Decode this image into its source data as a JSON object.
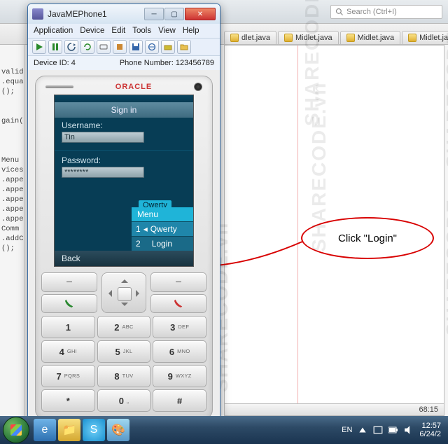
{
  "ide": {
    "search_placeholder": "Search (Ctrl+I)",
    "tabs": [
      {
        "label": "dlet.java"
      },
      {
        "label": "Midlet.java"
      },
      {
        "label": "Midlet.java"
      },
      {
        "label": "Midlet.java..."
      }
    ],
    "status": "68:15",
    "left_code": "\n\nvalid\n.equa\n();\n\n\ngain(\n\n\n\nMenu (\nvices\n.appe\n.appe\n.appe\n.appe\n.appe\nComm\n.addC\n();"
  },
  "annotation": {
    "text": "Click \"Login\""
  },
  "watermark": "SHARECODE.vn",
  "taskbar": {
    "lang": "EN",
    "time": "12:57",
    "date": "6/24/2"
  },
  "emuwin": {
    "title": "JavaMEPhone1",
    "menus": [
      "Application",
      "Device",
      "Edit",
      "Tools",
      "View",
      "Help"
    ],
    "device_id_label": "Device ID: 4",
    "phone_number_label": "Phone Number: 123456789"
  },
  "phone": {
    "brand": "ORACLE",
    "screen": {
      "header": "Sign in",
      "user_label": "Username:",
      "user_value": "Tin",
      "pass_label": "Password:",
      "pass_value": "********",
      "qwerty_badge": "Qwerty",
      "menu_header": "Menu",
      "menu_items": [
        {
          "num": "1",
          "label": "Qwerty",
          "arrow": "◂"
        },
        {
          "num": "2",
          "label": "Login",
          "arrow": ""
        }
      ],
      "soft_left": "Back"
    },
    "numkeys": [
      {
        "n": "1",
        "s": ""
      },
      {
        "n": "2",
        "s": "ABC"
      },
      {
        "n": "3",
        "s": "DEF"
      },
      {
        "n": "4",
        "s": "GHI"
      },
      {
        "n": "5",
        "s": "JKL"
      },
      {
        "n": "6",
        "s": "MNO"
      },
      {
        "n": "7",
        "s": "PQRS"
      },
      {
        "n": "8",
        "s": "TUV"
      },
      {
        "n": "9",
        "s": "WXYZ"
      },
      {
        "n": "*",
        "s": ""
      },
      {
        "n": "0",
        "s": "⎵"
      },
      {
        "n": "#",
        "s": ""
      }
    ]
  }
}
